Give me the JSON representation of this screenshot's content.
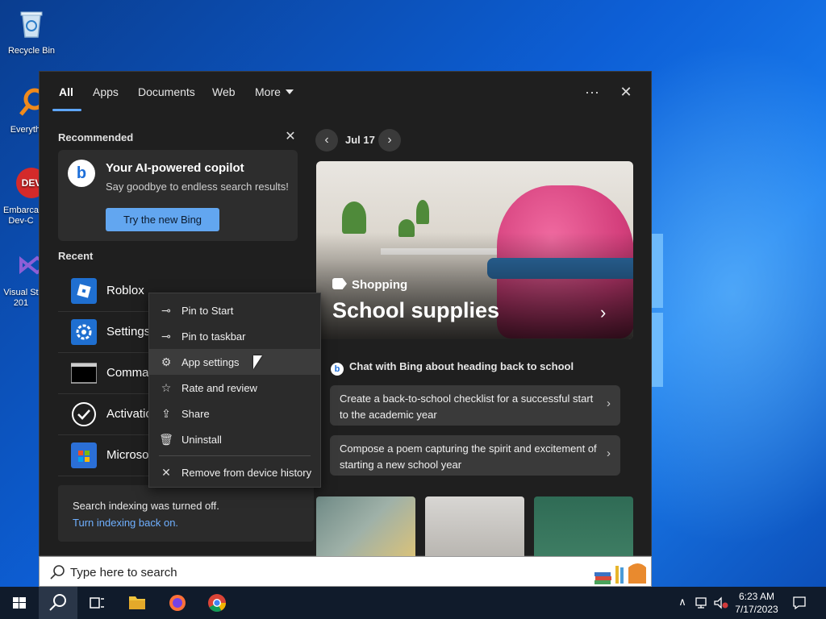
{
  "desktop": {
    "icons": [
      {
        "label": "Recycle Bin"
      },
      {
        "label": "Everyth"
      },
      {
        "label": "Embarca Dev-C"
      },
      {
        "label": "Visual St 201"
      }
    ]
  },
  "tabs": {
    "all": "All",
    "apps": "Apps",
    "documents": "Documents",
    "web": "Web",
    "more": "More",
    "options_glyph": "···",
    "close_glyph": "✕"
  },
  "recommended": {
    "heading": "Recommended",
    "dismiss_glyph": "✕",
    "badge": "b",
    "title": "Your AI-powered copilot",
    "subtitle": "Say goodbye to endless search results!",
    "button": "Try the new Bing"
  },
  "recent": {
    "heading": "Recent",
    "items": [
      {
        "name": "Roblox",
        "icon": "roblox-icon",
        "color": "#1f6fd0"
      },
      {
        "name": "Settings",
        "icon": "gear-icon",
        "color": "#1f6fd0"
      },
      {
        "name": "Comma",
        "icon": "terminal-icon",
        "color": "#000000"
      },
      {
        "name": "Activatio",
        "icon": "check-circle-icon",
        "color": "#1f1f1f"
      },
      {
        "name": "Microso",
        "icon": "store-icon",
        "color": "#2b6fd6"
      }
    ]
  },
  "notice": {
    "line1": "Search indexing was turned off.",
    "link": "Turn indexing back on."
  },
  "highlights": {
    "prev_glyph": "‹",
    "next_glyph": "›",
    "date": "Jul 17",
    "hero_tag": "Shopping",
    "hero_title": "School supplies",
    "hero_chevron": "›"
  },
  "chat": {
    "badge": "b",
    "heading": "Chat with Bing about heading back to school",
    "prompts": [
      {
        "text": "Create a back-to-school checklist for a successful start to the academic year",
        "chevron": "›"
      },
      {
        "text": "Compose a poem capturing the spirit and excitement of starting a new school year",
        "chevron": "›"
      }
    ]
  },
  "context_menu": {
    "items": [
      {
        "label": "Pin to Start",
        "icon": "pin-icon",
        "glyph": "⊸"
      },
      {
        "label": "Pin to taskbar",
        "icon": "pin-icon",
        "glyph": "⊸"
      },
      {
        "label": "App settings",
        "icon": "gear-icon",
        "glyph": "⚙"
      },
      {
        "label": "Rate and review",
        "icon": "star-icon",
        "glyph": "☆"
      },
      {
        "label": "Share",
        "icon": "share-icon",
        "glyph": "⇪"
      },
      {
        "label": "Uninstall",
        "icon": "trash-icon",
        "glyph": "🗑"
      },
      {
        "label": "Remove from device history",
        "icon": "close-icon",
        "glyph": "✕"
      }
    ]
  },
  "search": {
    "placeholder": "Type here to search"
  },
  "taskbar": {
    "time": "6:23 AM",
    "date": "7/17/2023",
    "tray_glyph": "∧"
  },
  "colors": {
    "accent": "#5ea6ff",
    "bing_button": "#62a6f0",
    "link": "#6fb0ff"
  }
}
